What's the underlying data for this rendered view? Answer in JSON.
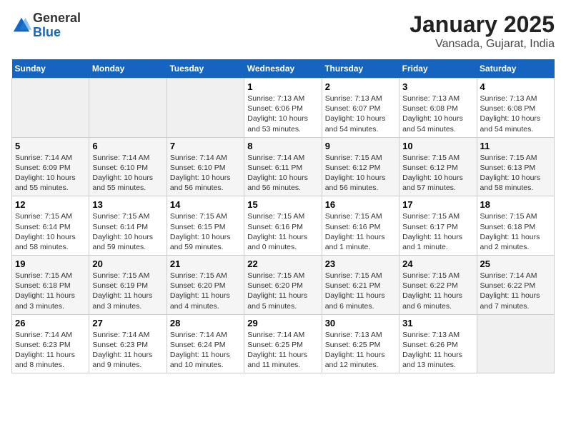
{
  "header": {
    "logo_line1": "General",
    "logo_line2": "Blue",
    "title": "January 2025",
    "subtitle": "Vansada, Gujarat, India"
  },
  "days_of_week": [
    "Sunday",
    "Monday",
    "Tuesday",
    "Wednesday",
    "Thursday",
    "Friday",
    "Saturday"
  ],
  "weeks": [
    [
      {
        "day": "",
        "info": ""
      },
      {
        "day": "",
        "info": ""
      },
      {
        "day": "",
        "info": ""
      },
      {
        "day": "1",
        "info": "Sunrise: 7:13 AM\nSunset: 6:06 PM\nDaylight: 10 hours\nand 53 minutes."
      },
      {
        "day": "2",
        "info": "Sunrise: 7:13 AM\nSunset: 6:07 PM\nDaylight: 10 hours\nand 54 minutes."
      },
      {
        "day": "3",
        "info": "Sunrise: 7:13 AM\nSunset: 6:08 PM\nDaylight: 10 hours\nand 54 minutes."
      },
      {
        "day": "4",
        "info": "Sunrise: 7:13 AM\nSunset: 6:08 PM\nDaylight: 10 hours\nand 54 minutes."
      }
    ],
    [
      {
        "day": "5",
        "info": "Sunrise: 7:14 AM\nSunset: 6:09 PM\nDaylight: 10 hours\nand 55 minutes."
      },
      {
        "day": "6",
        "info": "Sunrise: 7:14 AM\nSunset: 6:10 PM\nDaylight: 10 hours\nand 55 minutes."
      },
      {
        "day": "7",
        "info": "Sunrise: 7:14 AM\nSunset: 6:10 PM\nDaylight: 10 hours\nand 56 minutes."
      },
      {
        "day": "8",
        "info": "Sunrise: 7:14 AM\nSunset: 6:11 PM\nDaylight: 10 hours\nand 56 minutes."
      },
      {
        "day": "9",
        "info": "Sunrise: 7:15 AM\nSunset: 6:12 PM\nDaylight: 10 hours\nand 56 minutes."
      },
      {
        "day": "10",
        "info": "Sunrise: 7:15 AM\nSunset: 6:12 PM\nDaylight: 10 hours\nand 57 minutes."
      },
      {
        "day": "11",
        "info": "Sunrise: 7:15 AM\nSunset: 6:13 PM\nDaylight: 10 hours\nand 58 minutes."
      }
    ],
    [
      {
        "day": "12",
        "info": "Sunrise: 7:15 AM\nSunset: 6:14 PM\nDaylight: 10 hours\nand 58 minutes."
      },
      {
        "day": "13",
        "info": "Sunrise: 7:15 AM\nSunset: 6:14 PM\nDaylight: 10 hours\nand 59 minutes."
      },
      {
        "day": "14",
        "info": "Sunrise: 7:15 AM\nSunset: 6:15 PM\nDaylight: 10 hours\nand 59 minutes."
      },
      {
        "day": "15",
        "info": "Sunrise: 7:15 AM\nSunset: 6:16 PM\nDaylight: 11 hours\nand 0 minutes."
      },
      {
        "day": "16",
        "info": "Sunrise: 7:15 AM\nSunset: 6:16 PM\nDaylight: 11 hours\nand 1 minute."
      },
      {
        "day": "17",
        "info": "Sunrise: 7:15 AM\nSunset: 6:17 PM\nDaylight: 11 hours\nand 1 minute."
      },
      {
        "day": "18",
        "info": "Sunrise: 7:15 AM\nSunset: 6:18 PM\nDaylight: 11 hours\nand 2 minutes."
      }
    ],
    [
      {
        "day": "19",
        "info": "Sunrise: 7:15 AM\nSunset: 6:18 PM\nDaylight: 11 hours\nand 3 minutes."
      },
      {
        "day": "20",
        "info": "Sunrise: 7:15 AM\nSunset: 6:19 PM\nDaylight: 11 hours\nand 3 minutes."
      },
      {
        "day": "21",
        "info": "Sunrise: 7:15 AM\nSunset: 6:20 PM\nDaylight: 11 hours\nand 4 minutes."
      },
      {
        "day": "22",
        "info": "Sunrise: 7:15 AM\nSunset: 6:20 PM\nDaylight: 11 hours\nand 5 minutes."
      },
      {
        "day": "23",
        "info": "Sunrise: 7:15 AM\nSunset: 6:21 PM\nDaylight: 11 hours\nand 6 minutes."
      },
      {
        "day": "24",
        "info": "Sunrise: 7:15 AM\nSunset: 6:22 PM\nDaylight: 11 hours\nand 6 minutes."
      },
      {
        "day": "25",
        "info": "Sunrise: 7:14 AM\nSunset: 6:22 PM\nDaylight: 11 hours\nand 7 minutes."
      }
    ],
    [
      {
        "day": "26",
        "info": "Sunrise: 7:14 AM\nSunset: 6:23 PM\nDaylight: 11 hours\nand 8 minutes."
      },
      {
        "day": "27",
        "info": "Sunrise: 7:14 AM\nSunset: 6:23 PM\nDaylight: 11 hours\nand 9 minutes."
      },
      {
        "day": "28",
        "info": "Sunrise: 7:14 AM\nSunset: 6:24 PM\nDaylight: 11 hours\nand 10 minutes."
      },
      {
        "day": "29",
        "info": "Sunrise: 7:14 AM\nSunset: 6:25 PM\nDaylight: 11 hours\nand 11 minutes."
      },
      {
        "day": "30",
        "info": "Sunrise: 7:13 AM\nSunset: 6:25 PM\nDaylight: 11 hours\nand 12 minutes."
      },
      {
        "day": "31",
        "info": "Sunrise: 7:13 AM\nSunset: 6:26 PM\nDaylight: 11 hours\nand 13 minutes."
      },
      {
        "day": "",
        "info": ""
      }
    ]
  ]
}
